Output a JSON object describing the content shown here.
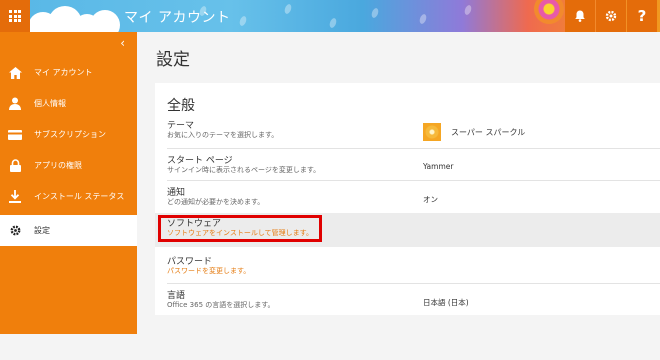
{
  "header": {
    "app_title": "マイ アカウント",
    "bell_icon": "bell-icon",
    "gear_icon": "gear-icon",
    "help_label": "?"
  },
  "sidebar": {
    "collapse_label": "‹",
    "items": [
      {
        "label": "マイ アカウント",
        "icon": "home-icon"
      },
      {
        "label": "個人情報",
        "icon": "person-icon"
      },
      {
        "label": "サブスクリプション",
        "icon": "card-icon"
      },
      {
        "label": "アプリの権限",
        "icon": "lock-icon"
      },
      {
        "label": "インストール ステータス",
        "icon": "download-icon"
      },
      {
        "label": "設定",
        "icon": "gear-icon"
      }
    ]
  },
  "main": {
    "page_title": "設定",
    "section_title": "全般",
    "rows": [
      {
        "name": "テーマ",
        "desc": "お気に入りのテーマを選択します。",
        "value": "スーパー スパークル"
      },
      {
        "name": "スタート ページ",
        "desc": "サインイン時に表示されるページを変更します。",
        "value": "Yammer"
      },
      {
        "name": "通知",
        "desc": "どの通知が必要かを決めます。",
        "value": "オン"
      },
      {
        "name": "ソフトウェア",
        "desc": "ソフトウェアをインストールして管理します。",
        "value": ""
      },
      {
        "name": "パスワード",
        "desc": "パスワードを変更します。",
        "value": ""
      },
      {
        "name": "言語",
        "desc": "Office 365 の言語を選択します。",
        "value": "日本語 (日本)"
      }
    ]
  },
  "colors": {
    "accent": "#f07f0c",
    "highlight_box": "#e00000",
    "link_orange": "#e57c12"
  }
}
